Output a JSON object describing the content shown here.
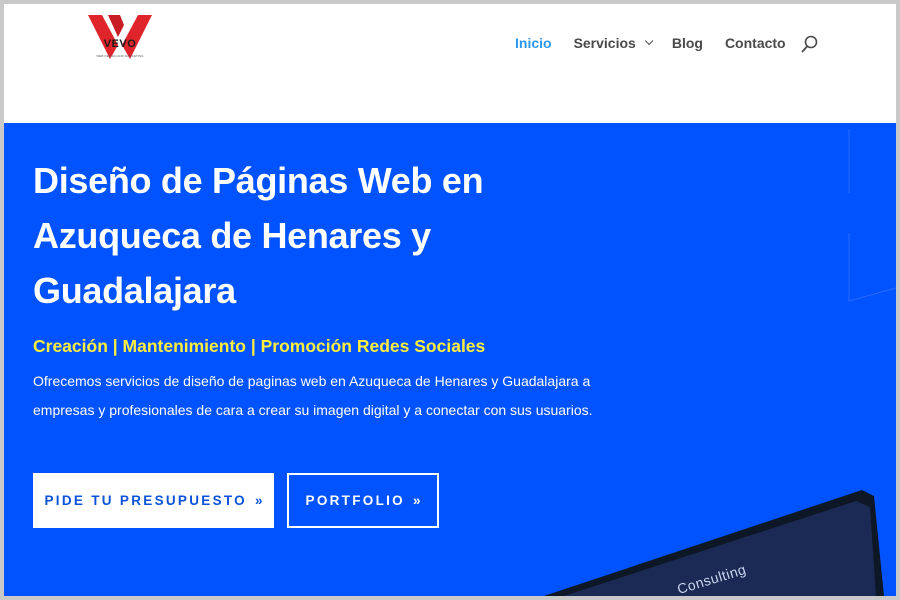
{
  "brand": {
    "name": "VEVO",
    "tagline": "WEB DESIGN AND MARKETING",
    "mark_color": "#e0242b"
  },
  "nav": {
    "items": [
      {
        "label": "Inicio",
        "active": true
      },
      {
        "label": "Servicios",
        "has_dropdown": true
      },
      {
        "label": "Blog"
      },
      {
        "label": "Contacto"
      }
    ],
    "search_icon": "search-icon"
  },
  "hero": {
    "title": "Diseño de Páginas Web en Azuqueca de Henares y Guadalajara",
    "subtitle": "Creación | Mantenimiento | Promoción Redes Sociales",
    "description": "Ofrecemos servicios de diseño de paginas web en Azuqueca de Henares y Guadalajara a empresas y profesionales de cara a crear su imagen digital y a conectar con sus usuarios.",
    "primary_button": "Pide tu presupuesto",
    "secondary_button": "Portfolio",
    "button_arrow": "»",
    "device_screen_text": "Consulting",
    "background": "#0153ff",
    "subtitle_color": "#ffef3d"
  },
  "colors": {
    "nav_active": "#2b97ef",
    "nav_text": "#4a4a4a"
  }
}
